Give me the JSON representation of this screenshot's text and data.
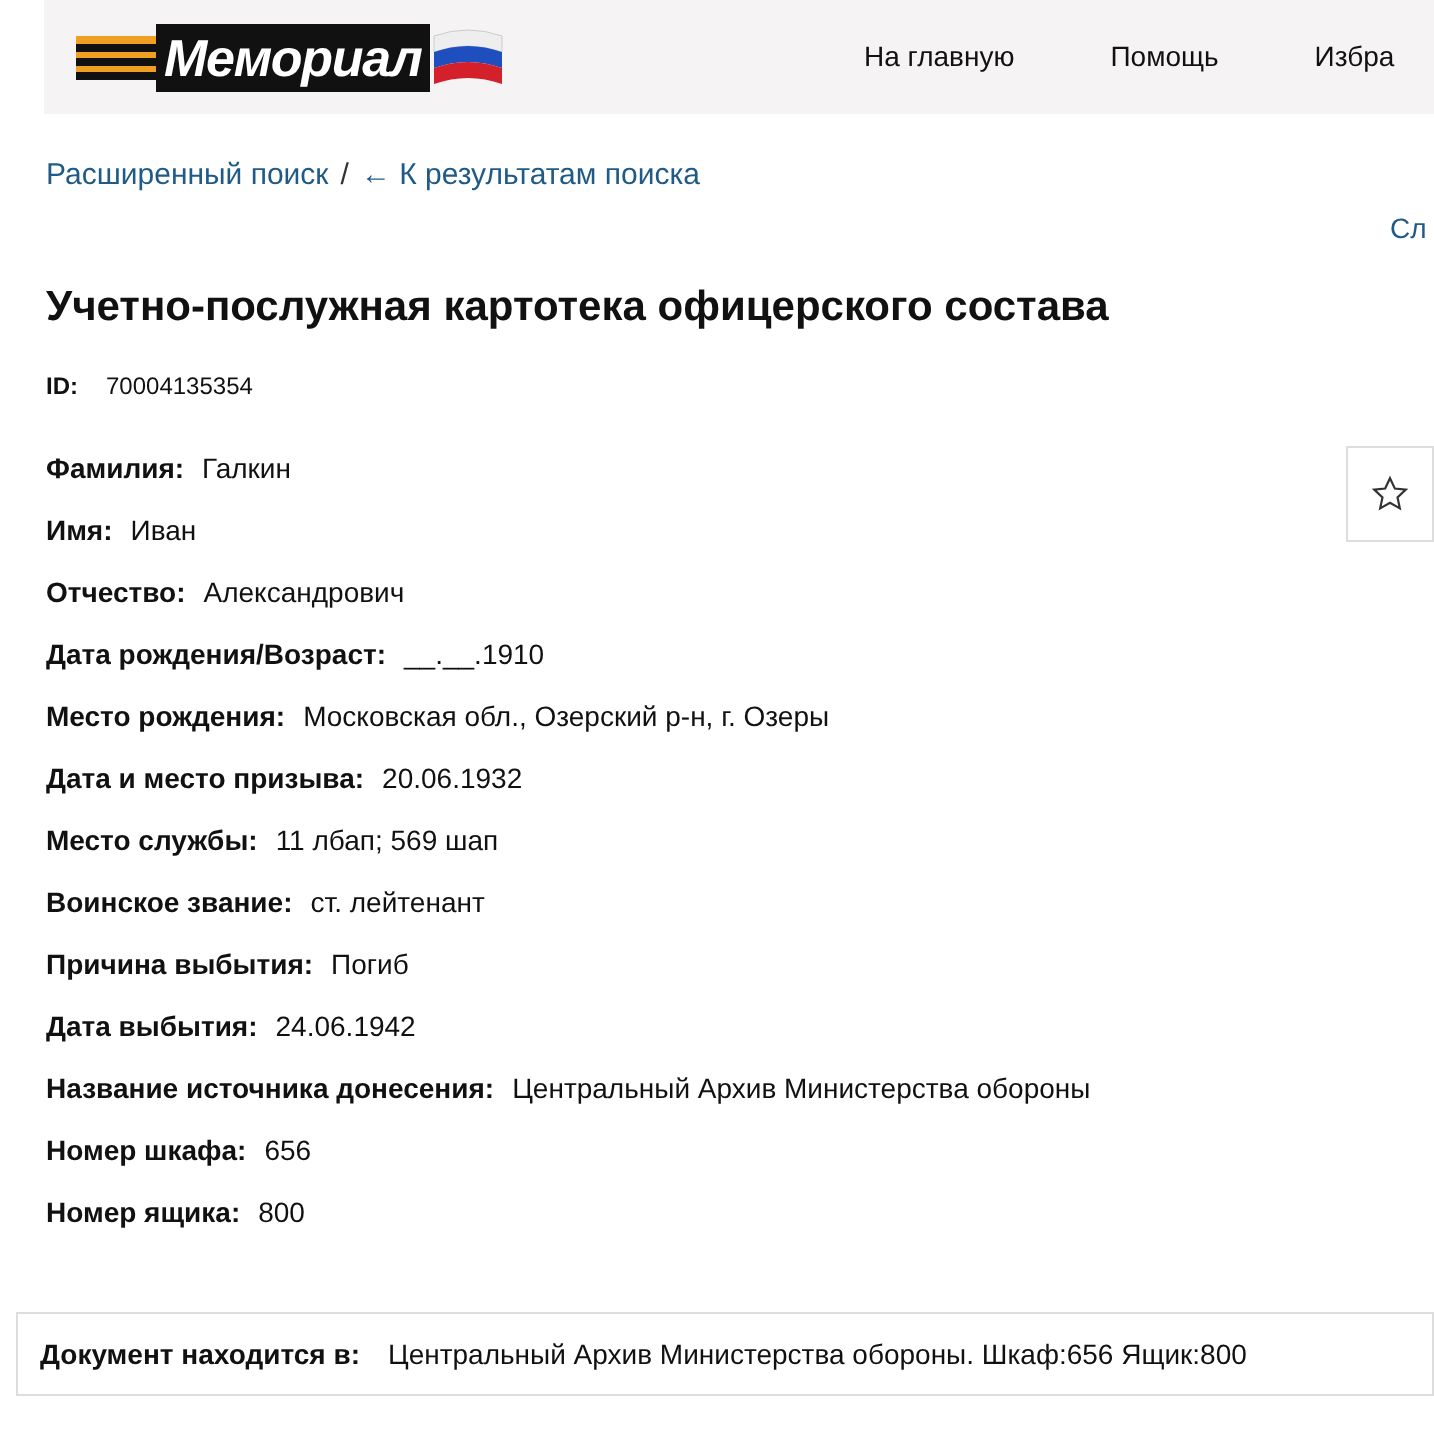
{
  "header": {
    "logo": "Мемориал",
    "nav": [
      "На главную",
      "Помощь",
      "Избра"
    ]
  },
  "breadcrumbs": {
    "links": [
      "Расширенный поиск",
      "← К результатам поиска"
    ],
    "separator": "/"
  },
  "next_link": "Сл",
  "title": "Учетно-послужная картотека офицерского состава",
  "id": {
    "label": "ID:",
    "value": "70004135354"
  },
  "fields": [
    {
      "label": "Фамилия:",
      "value": "Галкин"
    },
    {
      "label": "Имя:",
      "value": "Иван"
    },
    {
      "label": "Отчество:",
      "value": "Александрович"
    },
    {
      "label": "Дата рождения/Возраст:",
      "value": "__.__.1910"
    },
    {
      "label": "Место рождения:",
      "value": "Московская обл., Озерский р-н, г. Озеры"
    },
    {
      "label": "Дата и место призыва:",
      "value": "20.06.1932"
    },
    {
      "label": "Место службы:",
      "value": "11 лбап; 569 шап"
    },
    {
      "label": "Воинское звание:",
      "value": "ст. лейтенант"
    },
    {
      "label": "Причина выбытия:",
      "value": "Погиб"
    },
    {
      "label": "Дата выбытия:",
      "value": "24.06.1942"
    },
    {
      "label": "Название источника донесения:",
      "value": "Центральный Архив Министерства обороны"
    },
    {
      "label": "Номер шкафа:",
      "value": "656"
    },
    {
      "label": "Номер ящика:",
      "value": "800"
    }
  ],
  "location": {
    "label": "Документ находится в:",
    "value": "Центральный Архив Министерства обороны. Шкаф:656 Ящик:800"
  }
}
